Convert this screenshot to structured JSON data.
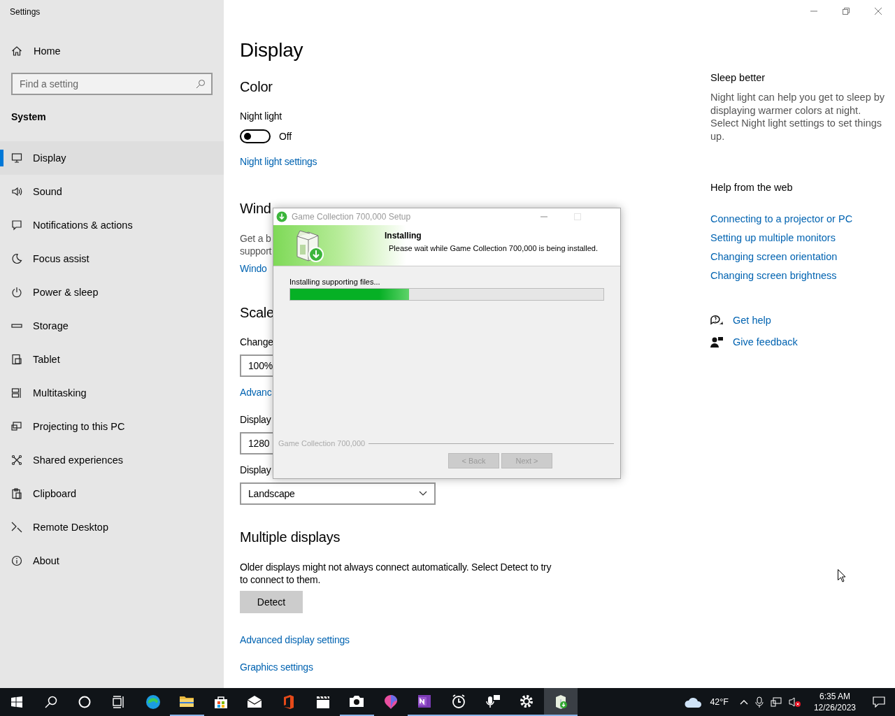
{
  "window": {
    "title": "Settings"
  },
  "sidebar": {
    "home": "Home",
    "search": {
      "placeholder": "Find a setting"
    },
    "section": "System",
    "items": [
      {
        "label": "Display",
        "selected": true
      },
      {
        "label": "Sound",
        "selected": false
      },
      {
        "label": "Notifications & actions",
        "selected": false
      },
      {
        "label": "Focus assist",
        "selected": false
      },
      {
        "label": "Power & sleep",
        "selected": false
      },
      {
        "label": "Storage",
        "selected": false
      },
      {
        "label": "Tablet",
        "selected": false
      },
      {
        "label": "Multitasking",
        "selected": false
      },
      {
        "label": "Projecting to this PC",
        "selected": false
      },
      {
        "label": "Shared experiences",
        "selected": false
      },
      {
        "label": "Clipboard",
        "selected": false
      },
      {
        "label": "Remote Desktop",
        "selected": false
      },
      {
        "label": "About",
        "selected": false
      }
    ]
  },
  "page": {
    "title": "Display",
    "color_heading": "Color",
    "night_light": {
      "label": "Night light",
      "on": false,
      "state_text": "Off",
      "link": "Night light settings"
    },
    "hd_heading": "Wind",
    "hd_text": [
      "Get a b",
      "support"
    ],
    "hd_link": "Windo",
    "scale_heading": "Scale",
    "scale_label": "Change",
    "scale_value": "100%",
    "advanced_link": "Advanc",
    "resolution_label": "Display",
    "resolution_value": "1280",
    "orientation_label": "Display",
    "orientation_value": "Landscape",
    "multiple_heading": "Multiple displays",
    "multiple_text": "Older displays might not always connect automatically. Select Detect to try to connect to them.",
    "detect_button": "Detect",
    "links": [
      "Advanced display settings",
      "Graphics settings"
    ]
  },
  "aside": {
    "sleep_heading": "Sleep better",
    "sleep_text": "Night light can help you get to sleep by displaying warmer colors at night. Select Night light settings to set things up.",
    "help_heading": "Help from the web",
    "help_links": [
      "Connecting to a projector or PC",
      "Setting up multiple monitors",
      "Changing screen orientation",
      "Changing screen brightness"
    ],
    "get_help": "Get help",
    "feedback": "Give feedback"
  },
  "dialog": {
    "title": "Game Collection 700,000 Setup",
    "header_title": "Installing",
    "header_text": "Please wait while Game Collection 700,000 is being installed.",
    "status": "Installing supporting files...",
    "level": 0.38,
    "brand": "Game Collection 700,000",
    "buttons": [
      {
        "label": "< Back",
        "disabled": true
      },
      {
        "label": "Next >",
        "disabled": true
      }
    ]
  },
  "taskbar": {
    "apps": [
      {
        "kind": "edge",
        "running": false,
        "selected": false
      },
      {
        "kind": "folder",
        "running": true,
        "selected": false
      },
      {
        "kind": "store",
        "running": false,
        "selected": false
      },
      {
        "kind": "mail",
        "running": false,
        "selected": false
      },
      {
        "kind": "office",
        "running": false,
        "selected": false
      },
      {
        "kind": "film",
        "running": false,
        "selected": false
      },
      {
        "kind": "camera",
        "running": true,
        "selected": false
      },
      {
        "kind": "paint",
        "running": false,
        "selected": false
      },
      {
        "kind": "notes",
        "running": true,
        "selected": false
      },
      {
        "kind": "alarm",
        "running": true,
        "selected": false
      },
      {
        "kind": "recorder",
        "running": true,
        "selected": false
      },
      {
        "kind": "gear",
        "running": true,
        "selected": false
      },
      {
        "kind": "installer",
        "running": true,
        "selected": true
      }
    ],
    "temperature": "42°F",
    "time": "6:35 AM",
    "date": "12/26/2023"
  }
}
